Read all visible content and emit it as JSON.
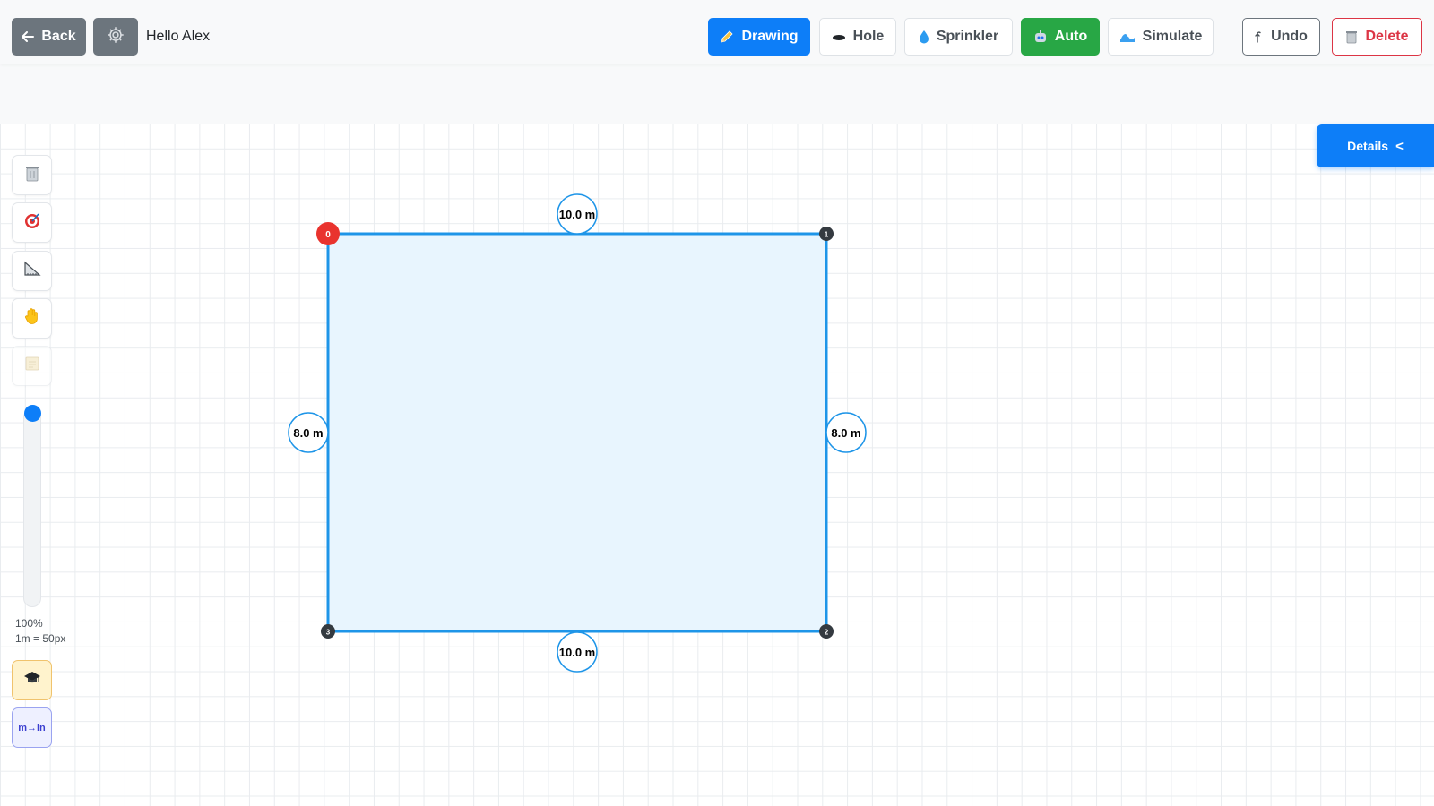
{
  "topbar": {
    "back_label": "Back",
    "greeting": "Hello Alex",
    "modes": {
      "drawing": "Drawing",
      "hole": "Hole",
      "sprinkler": "Sprinkler",
      "auto": "Auto",
      "simulate": "Simulate"
    },
    "undo_label": "Undo",
    "delete_label": "Delete"
  },
  "details": {
    "label": "Details",
    "chevron": "<"
  },
  "toolbar": {
    "tools": [
      "trash-icon",
      "target-icon",
      "ruler-icon",
      "hand-icon",
      "notepad-icon"
    ],
    "zoom_percent": "100%",
    "scale_label": "1m = 50px",
    "unit_toggle": "m→in"
  },
  "shape": {
    "vertices": [
      "0",
      "1",
      "2",
      "3"
    ],
    "edges": {
      "top": "10.0 m",
      "right": "8.0 m",
      "bottom": "10.0 m",
      "left": "8.0 m"
    }
  },
  "colors": {
    "primary": "#0d7ef8",
    "success": "#28a745",
    "danger": "#dc3545",
    "secondary": "#6c757d",
    "shape_stroke": "#1e95e8",
    "shape_fill": "#e8f5fe",
    "start_vertex": "#e9332e"
  }
}
